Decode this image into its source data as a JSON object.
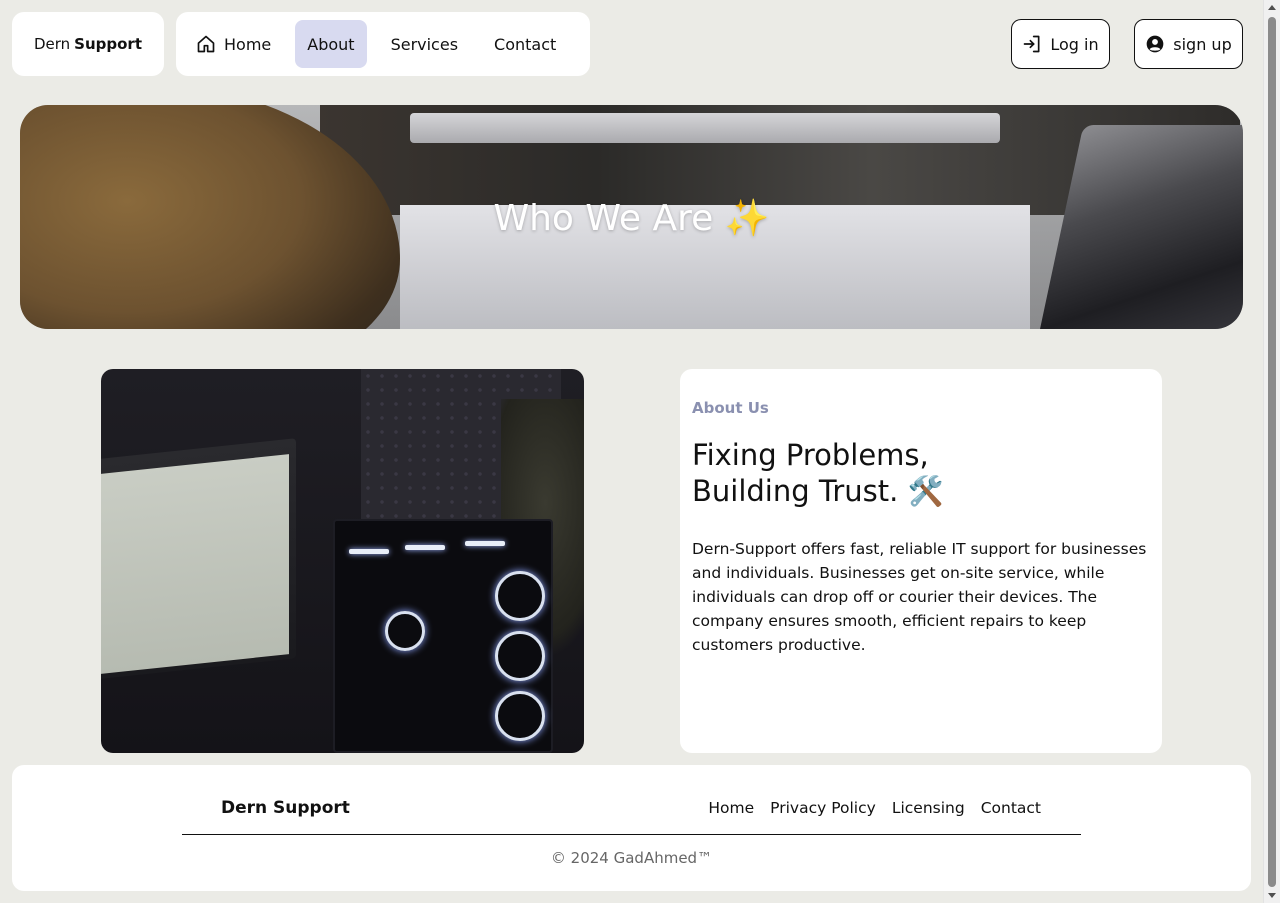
{
  "header": {
    "brand_regular": "Dern",
    "brand_bold": "Support",
    "nav": [
      {
        "label": "Home",
        "icon": "home-icon"
      },
      {
        "label": "About",
        "active": true
      },
      {
        "label": "Services"
      },
      {
        "label": "Contact"
      }
    ],
    "login_label": "Log in",
    "signup_label": "sign up"
  },
  "hero": {
    "title": "Who We Are ✨"
  },
  "about": {
    "label": "About Us",
    "heading_line1": "Fixing Problems,",
    "heading_line2": "Building Trust. 🛠️",
    "body": "Dern-Support offers fast, reliable IT support for businesses and individuals. Businesses get on-site service, while individuals can drop off or courier their devices. The company ensures smooth, efficient repairs to keep customers productive."
  },
  "footer": {
    "brand": "Dern Support",
    "links": [
      "Home",
      "Privacy Policy",
      "Licensing",
      "Contact"
    ],
    "copyright": "© 2024 GadAhmed™"
  },
  "colors": {
    "page_bg": "#ebebe6",
    "active_nav_bg": "#d8daf0",
    "about_label": "#8a90b0"
  }
}
